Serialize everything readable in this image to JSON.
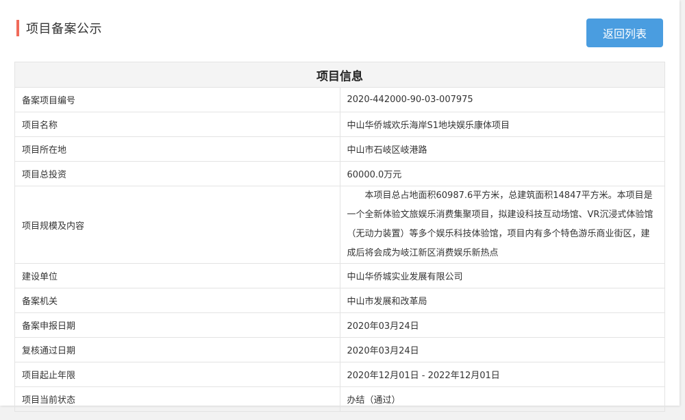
{
  "header": {
    "title": "项目备案公示",
    "back_button_label": "返回列表",
    "accent_color": "#f06a5a",
    "button_color": "#4a9de0"
  },
  "table": {
    "caption": "项目信息",
    "rows": [
      {
        "label": "备案项目编号",
        "value": "2020-442000-90-03-007975"
      },
      {
        "label": "项目名称",
        "value": "中山华侨城欢乐海岸S1地块娱乐康体项目"
      },
      {
        "label": "项目所在地",
        "value": "中山市石岐区岐港路"
      },
      {
        "label": "项目总投资",
        "value": "60000.0万元"
      },
      {
        "label": "项目规模及内容",
        "value": "本项目总占地面积60987.6平方米，总建筑面积14847平方米。本项目是一个全新体验文旅娱乐消费集聚项目，拟建设科技互动场馆、VR沉浸式体验馆（无动力装置）等多个娱乐科技体验馆，项目内有多个特色游乐商业街区，建成后将会成为岐江新区消费娱乐新热点"
      },
      {
        "label": "建设单位",
        "value": "中山华侨城实业发展有限公司"
      },
      {
        "label": "备案机关",
        "value": "中山市发展和改革局"
      },
      {
        "label": "备案申报日期",
        "value": "2020年03月24日"
      },
      {
        "label": "复核通过日期",
        "value": "2020年03月24日"
      },
      {
        "label": "项目起止年限",
        "value": "2020年12月01日 - 2022年12月01日"
      },
      {
        "label": "项目当前状态",
        "value": "办结（通过）"
      }
    ]
  }
}
